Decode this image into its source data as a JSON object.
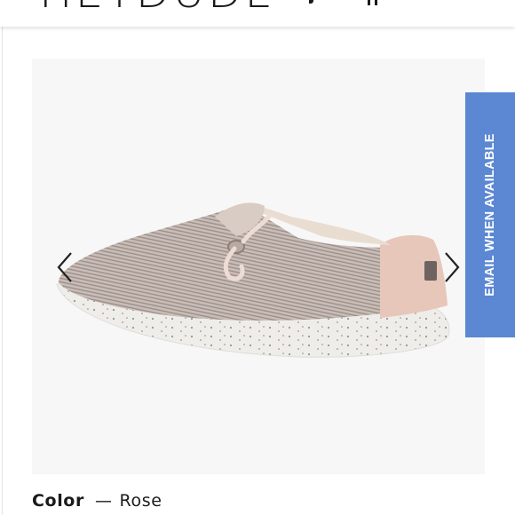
{
  "header": {
    "logo_text": "HEYDUDE",
    "icons": [
      "search-icon",
      "account-icon"
    ]
  },
  "gallery": {
    "image_description_icon": "product-image",
    "prev_icon": "chevron-left-icon",
    "next_icon": "chevron-right-icon"
  },
  "email_tab": {
    "label": "EMAIL WHEN AVAILABLE"
  },
  "product": {
    "color_label": "Color",
    "separator": "—",
    "color_value": "Rose"
  },
  "colors": {
    "email_tab_bg": "#5b87d3",
    "gallery_bg": "#f7f7f7",
    "text": "#1a1a1a"
  }
}
